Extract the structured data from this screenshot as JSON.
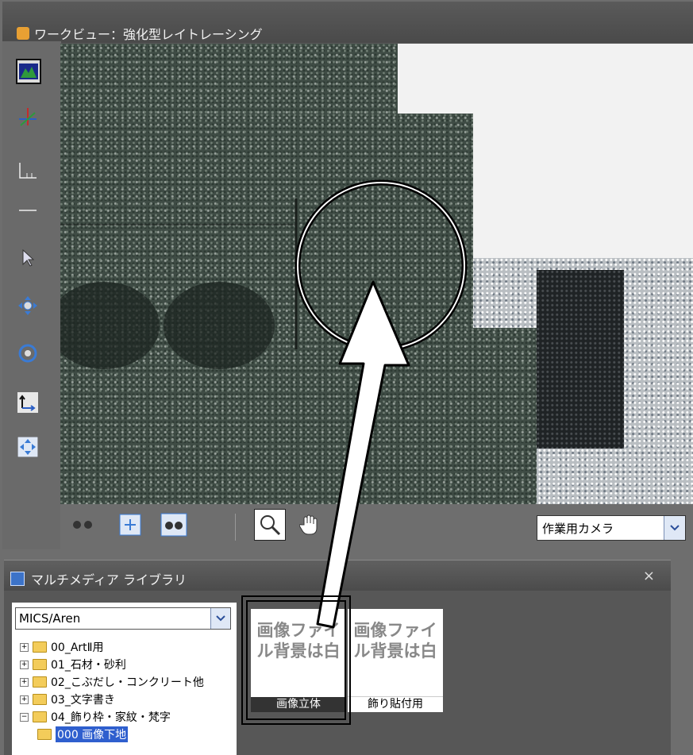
{
  "window": {
    "title": "ワークビュー：強化型レイトレーシング"
  },
  "left_toolbar": {
    "buttons": [
      "render-icon",
      "axis-icon",
      "ruler-icon",
      "line-icon",
      "pointer-icon",
      "move-icon",
      "rotate-icon",
      "snap-icon",
      "fit-icon"
    ]
  },
  "bottom_bar": {
    "camera_value": "作業用カメラ"
  },
  "library": {
    "title": "マルチメディア ライブラリ",
    "close": "×",
    "folder_path": "MICS/Aren",
    "tree": [
      {
        "label": "00_ArtⅡ用",
        "expander": "+"
      },
      {
        "label": "01_石材・砂利",
        "expander": "+"
      },
      {
        "label": "02_こぶだし・コンクリート他",
        "expander": "+"
      },
      {
        "label": "03_文字書き",
        "expander": "+"
      },
      {
        "label": "04_飾り枠・家紋・梵字",
        "expander": "−"
      },
      {
        "label": "000 画像下地",
        "expander": ""
      }
    ],
    "thumbnails": [
      {
        "image_text": "画像ファイル背景は白",
        "label": "画像立体",
        "selected": true
      },
      {
        "image_text": "画像ファイル背景は白",
        "label": "飾り貼付用",
        "selected": false
      }
    ]
  }
}
